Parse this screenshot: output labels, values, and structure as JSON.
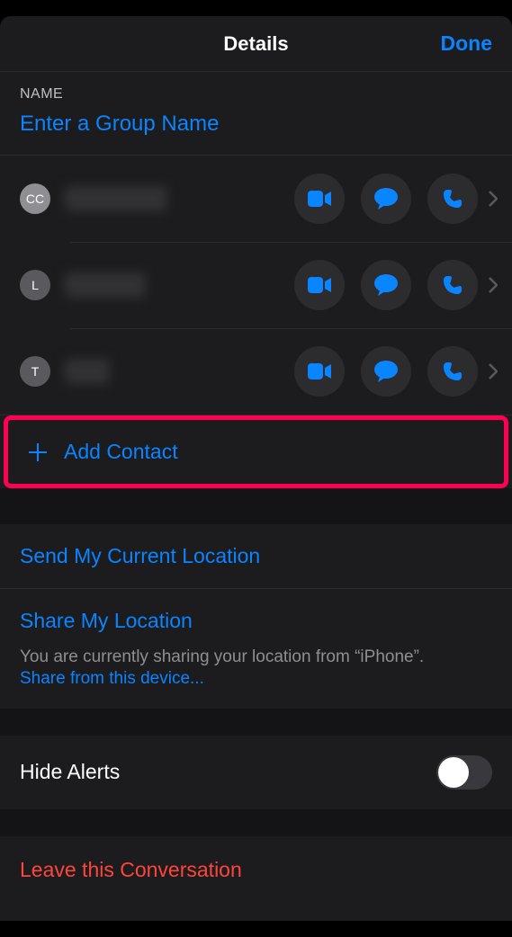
{
  "header": {
    "title": "Details",
    "done": "Done"
  },
  "name_section": {
    "label": "NAME",
    "placeholder": "Enter a Group Name"
  },
  "contacts": [
    {
      "initials": "CC",
      "avatarDark": false
    },
    {
      "initials": "L",
      "avatarDark": true
    },
    {
      "initials": "T",
      "avatarDark": true
    }
  ],
  "add_contact": {
    "label": "+ Add Contact",
    "text_only": "Add Contact"
  },
  "location": {
    "send_current": "Send My Current Location",
    "share": "Share My Location",
    "body": "You are currently sharing your location from “iPhone”.",
    "share_device": "Share from this device..."
  },
  "hide_alerts": {
    "label": "Hide Alerts",
    "enabled": false
  },
  "leave": {
    "label": "Leave this Conversation"
  },
  "colors": {
    "accent": "#0a84ff",
    "destructive": "#ff453a"
  }
}
